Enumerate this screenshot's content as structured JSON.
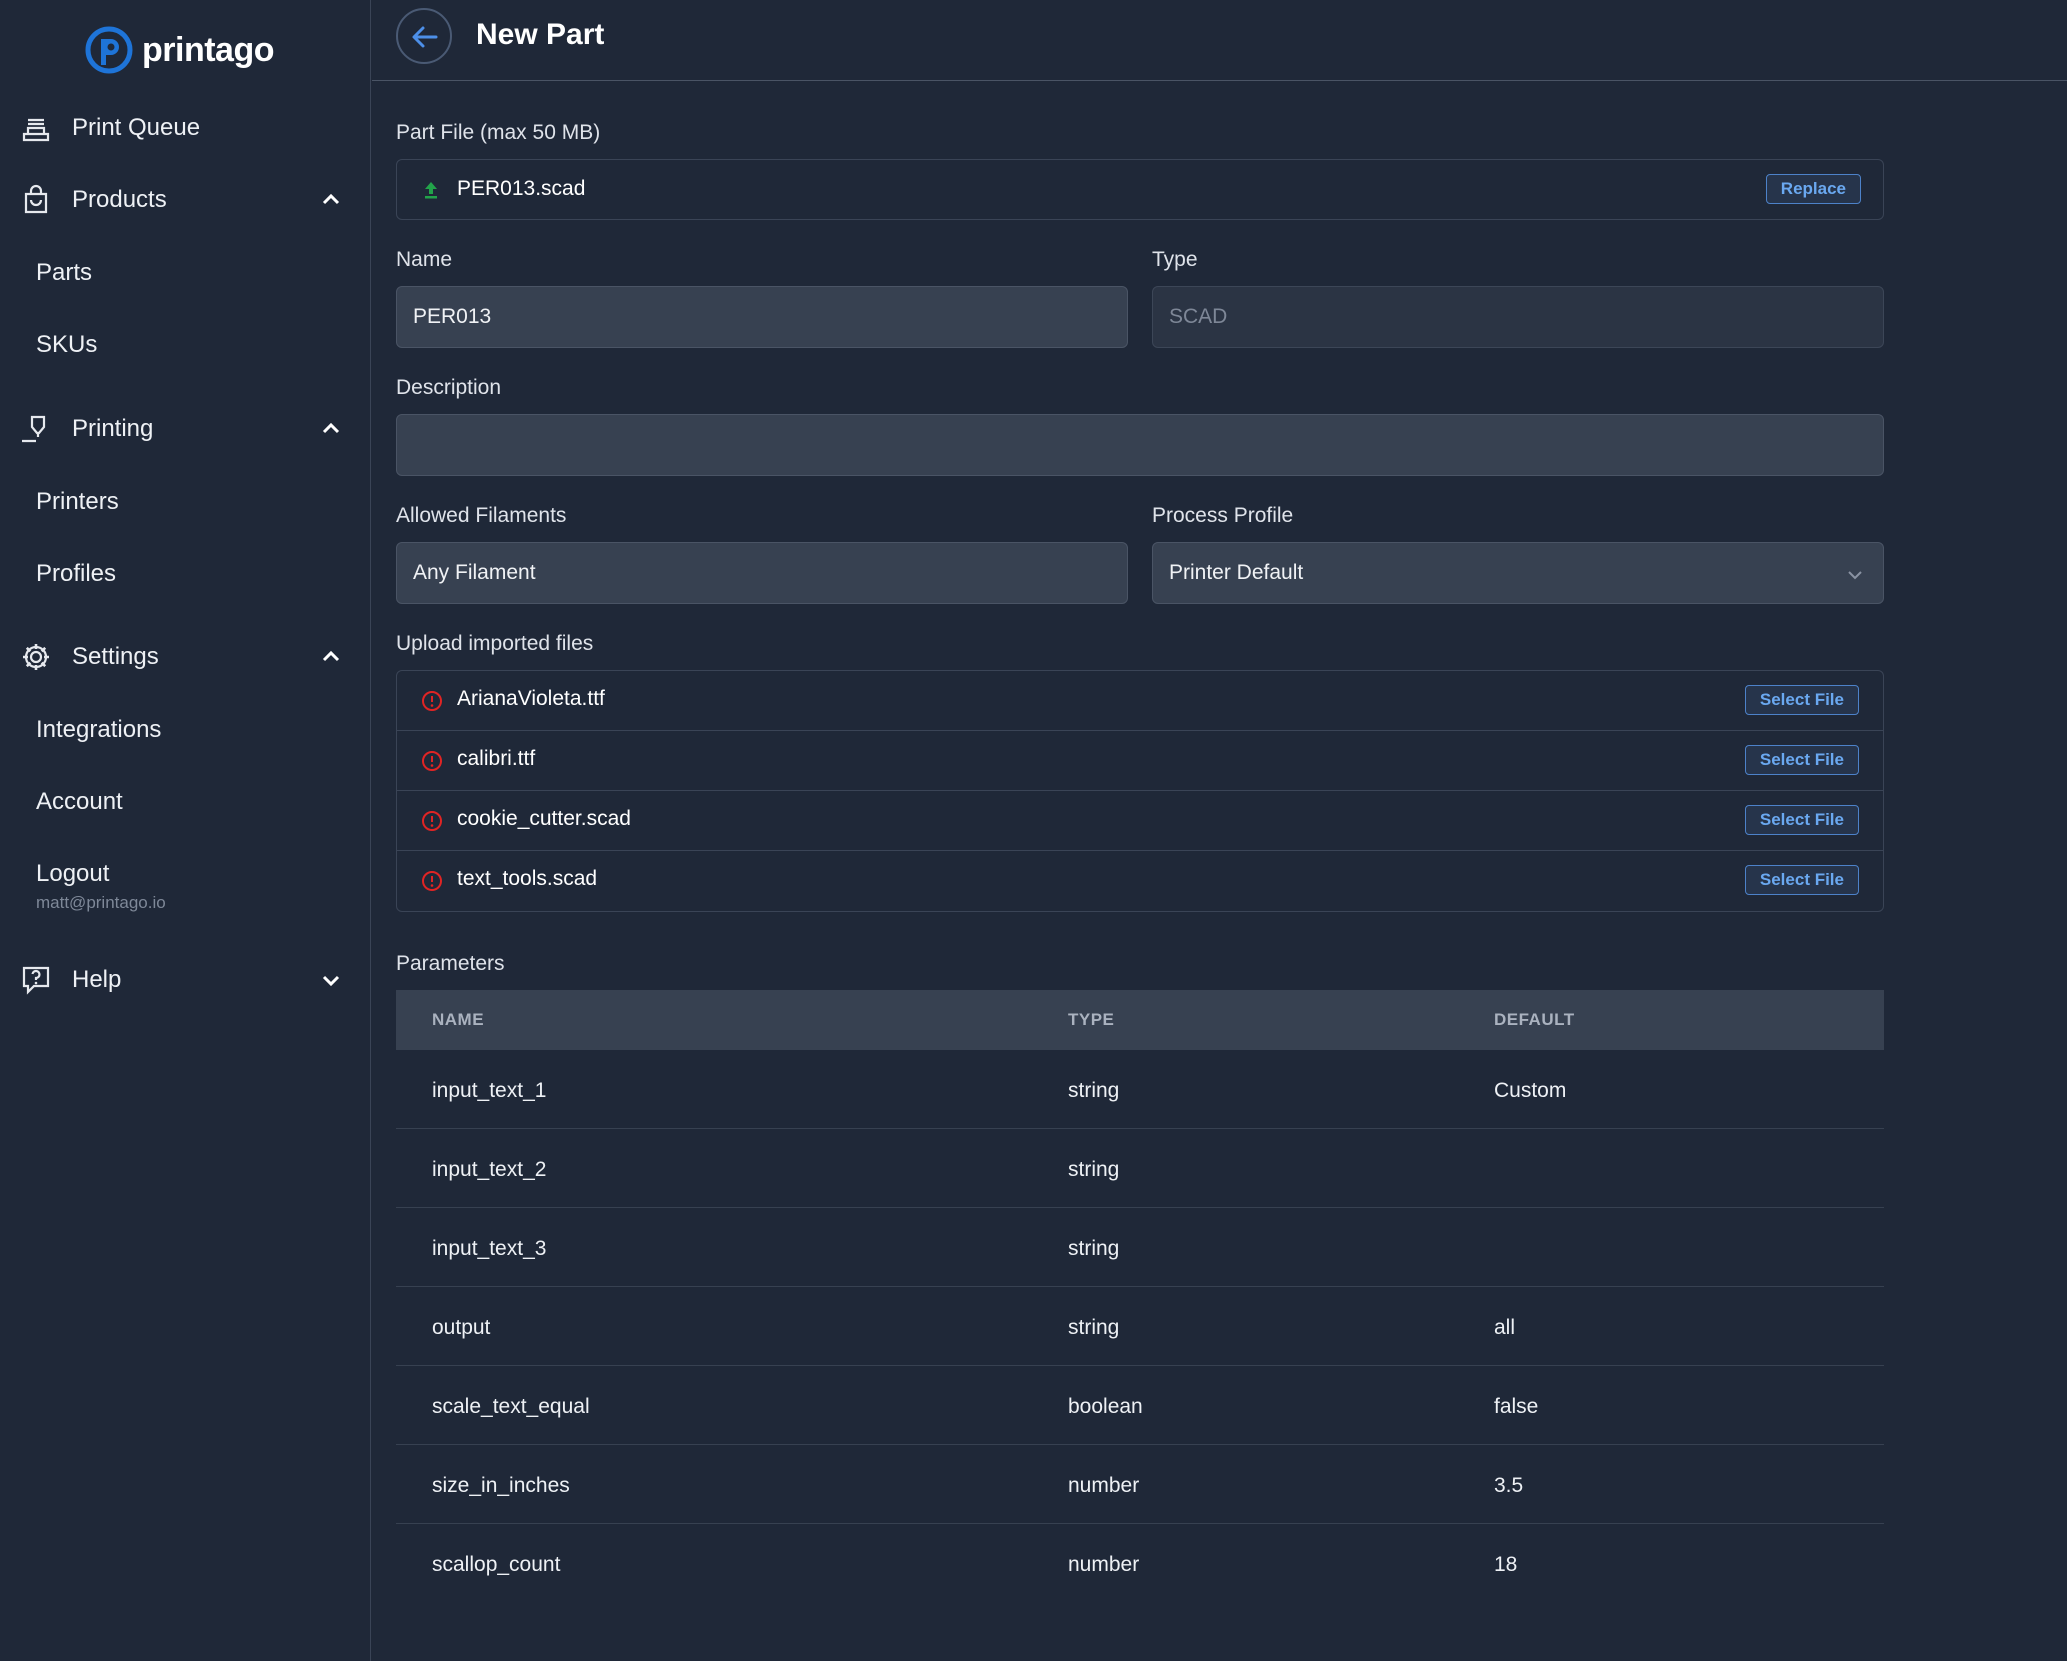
{
  "brand": {
    "name": "printago",
    "accent": "#1e74d8"
  },
  "sidebar": {
    "items": [
      {
        "label": "Print Queue",
        "icon": "print-queue-icon"
      },
      {
        "label": "Products",
        "icon": "shopping-bag-icon",
        "expanded": true,
        "children": [
          {
            "label": "Parts"
          },
          {
            "label": "SKUs"
          }
        ]
      },
      {
        "label": "Printing",
        "icon": "printer-nozzle-icon",
        "expanded": true,
        "children": [
          {
            "label": "Printers"
          },
          {
            "label": "Profiles"
          }
        ]
      },
      {
        "label": "Settings",
        "icon": "gear-icon",
        "expanded": true,
        "children": [
          {
            "label": "Integrations"
          },
          {
            "label": "Account"
          },
          {
            "label": "Logout"
          }
        ]
      },
      {
        "label": "Help",
        "icon": "help-icon",
        "expanded": false
      }
    ],
    "user_email": "matt@printago.io"
  },
  "header": {
    "title": "New Part"
  },
  "form": {
    "part_file": {
      "label": "Part File (max 50 MB)",
      "file_name": "PER013.scad",
      "replace_label": "Replace"
    },
    "name": {
      "label": "Name",
      "value": "PER013"
    },
    "type": {
      "label": "Type",
      "value": "SCAD"
    },
    "description": {
      "label": "Description",
      "value": ""
    },
    "allowed_filaments": {
      "label": "Allowed Filaments",
      "value": "Any Filament"
    },
    "process_profile": {
      "label": "Process Profile",
      "value": "Printer Default"
    },
    "uploads": {
      "label": "Upload imported files",
      "button_label": "Select File",
      "files": [
        "ArianaVioleta.ttf",
        "calibri.ttf",
        "cookie_cutter.scad",
        "text_tools.scad"
      ]
    }
  },
  "parameters": {
    "label": "Parameters",
    "columns": [
      "NAME",
      "TYPE",
      "DEFAULT"
    ],
    "rows": [
      [
        "input_text_1",
        "string",
        "Custom"
      ],
      [
        "input_text_2",
        "string",
        ""
      ],
      [
        "input_text_3",
        "string",
        ""
      ],
      [
        "output",
        "string",
        "all"
      ],
      [
        "scale_text_equal",
        "boolean",
        "false"
      ],
      [
        "size_in_inches",
        "number",
        "3.5"
      ],
      [
        "scallop_count",
        "number",
        "18"
      ]
    ]
  }
}
